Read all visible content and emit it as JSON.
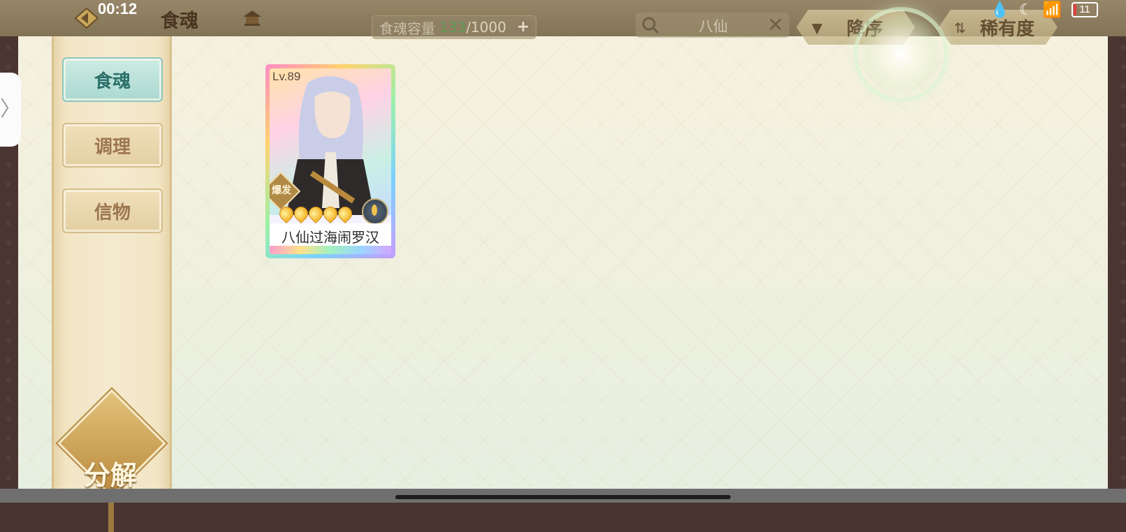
{
  "status_bar": {
    "time": "00:12",
    "battery": "11"
  },
  "header": {
    "title": "食魂",
    "capacity": {
      "label": "食魂容量",
      "current": "133",
      "max": "/1000"
    },
    "search": {
      "value": "八仙"
    },
    "sort_order_label": "降序",
    "sort_by_label": "稀有度"
  },
  "sidebar": {
    "items": [
      {
        "label": "食魂",
        "active": true
      },
      {
        "label": "调理",
        "active": false
      },
      {
        "label": "信物",
        "active": false
      }
    ],
    "decompose_label": "分解"
  },
  "cards": [
    {
      "level": "Lv.89",
      "type_badge": "爆发",
      "stars": 5,
      "name": "八仙过海闹罗汉"
    }
  ]
}
